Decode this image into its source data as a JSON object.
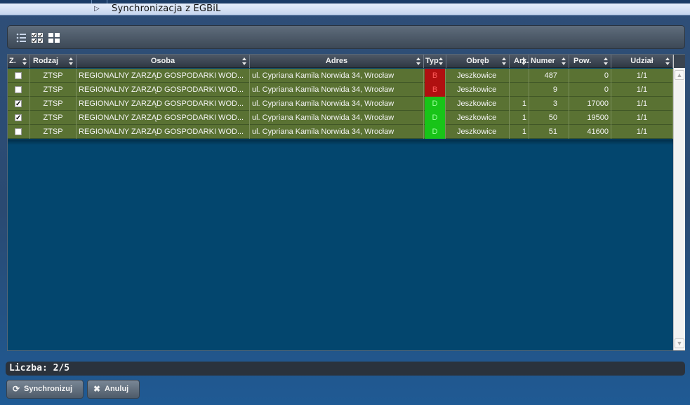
{
  "window": {
    "title": "Synchronizacja z EGBiL"
  },
  "toolbar": {
    "icons": [
      "list-icon",
      "check-all-icon",
      "tiles-icon"
    ]
  },
  "grid": {
    "columns": [
      "Z.",
      "Rodzaj",
      "Osoba",
      "Adres",
      "Typ",
      "Obręb",
      "Ark.",
      "Numer",
      "Pow.",
      "Udział"
    ],
    "rows": [
      {
        "checked": false,
        "rodzaj": "ZTSP",
        "osoba": "REGIONALNY ZARZĄD GOSPODARKI WOD...",
        "adres": "ul. Cypriana Kamila Norwida 34, Wrocław",
        "typ": "B",
        "obreb": "Jeszkowice",
        "ark": "",
        "numer": "487",
        "pow": "0",
        "udzial": "1/1"
      },
      {
        "checked": false,
        "rodzaj": "ZTSP",
        "osoba": "REGIONALNY ZARZĄD GOSPODARKI WOD...",
        "adres": "ul. Cypriana Kamila Norwida 34, Wrocław",
        "typ": "B",
        "obreb": "Jeszkowice",
        "ark": "",
        "numer": "9",
        "pow": "0",
        "udzial": "1/1"
      },
      {
        "checked": true,
        "rodzaj": "ZTSP",
        "osoba": "REGIONALNY ZARZĄD GOSPODARKI WOD...",
        "adres": "ul. Cypriana Kamila Norwida 34, Wrocław",
        "typ": "D",
        "obreb": "Jeszkowice",
        "ark": "1",
        "numer": "3",
        "pow": "17000",
        "udzial": "1/1"
      },
      {
        "checked": true,
        "rodzaj": "ZTSP",
        "osoba": "REGIONALNY ZARZĄD GOSPODARKI WOD...",
        "adres": "ul. Cypriana Kamila Norwida 34, Wrocław",
        "typ": "D",
        "obreb": "Jeszkowice",
        "ark": "1",
        "numer": "50",
        "pow": "19500",
        "udzial": "1/1"
      },
      {
        "checked": false,
        "rodzaj": "ZTSP",
        "osoba": "REGIONALNY ZARZĄD GOSPODARKI WOD...",
        "adres": "ul. Cypriana Kamila Norwida 34, Wrocław",
        "typ": "D",
        "obreb": "Jeszkowice",
        "ark": "1",
        "numer": "51",
        "pow": "41600",
        "udzial": "1/1"
      }
    ]
  },
  "status": {
    "label": "Liczba: 2/5"
  },
  "buttons": {
    "sync_label": "Synchronizuj",
    "cancel_label": "Anuluj"
  },
  "colors": {
    "row_bg": "#5a7233",
    "typ_b": "#b01010",
    "typ_d": "#18c418",
    "grid_bg": "#03466e"
  }
}
